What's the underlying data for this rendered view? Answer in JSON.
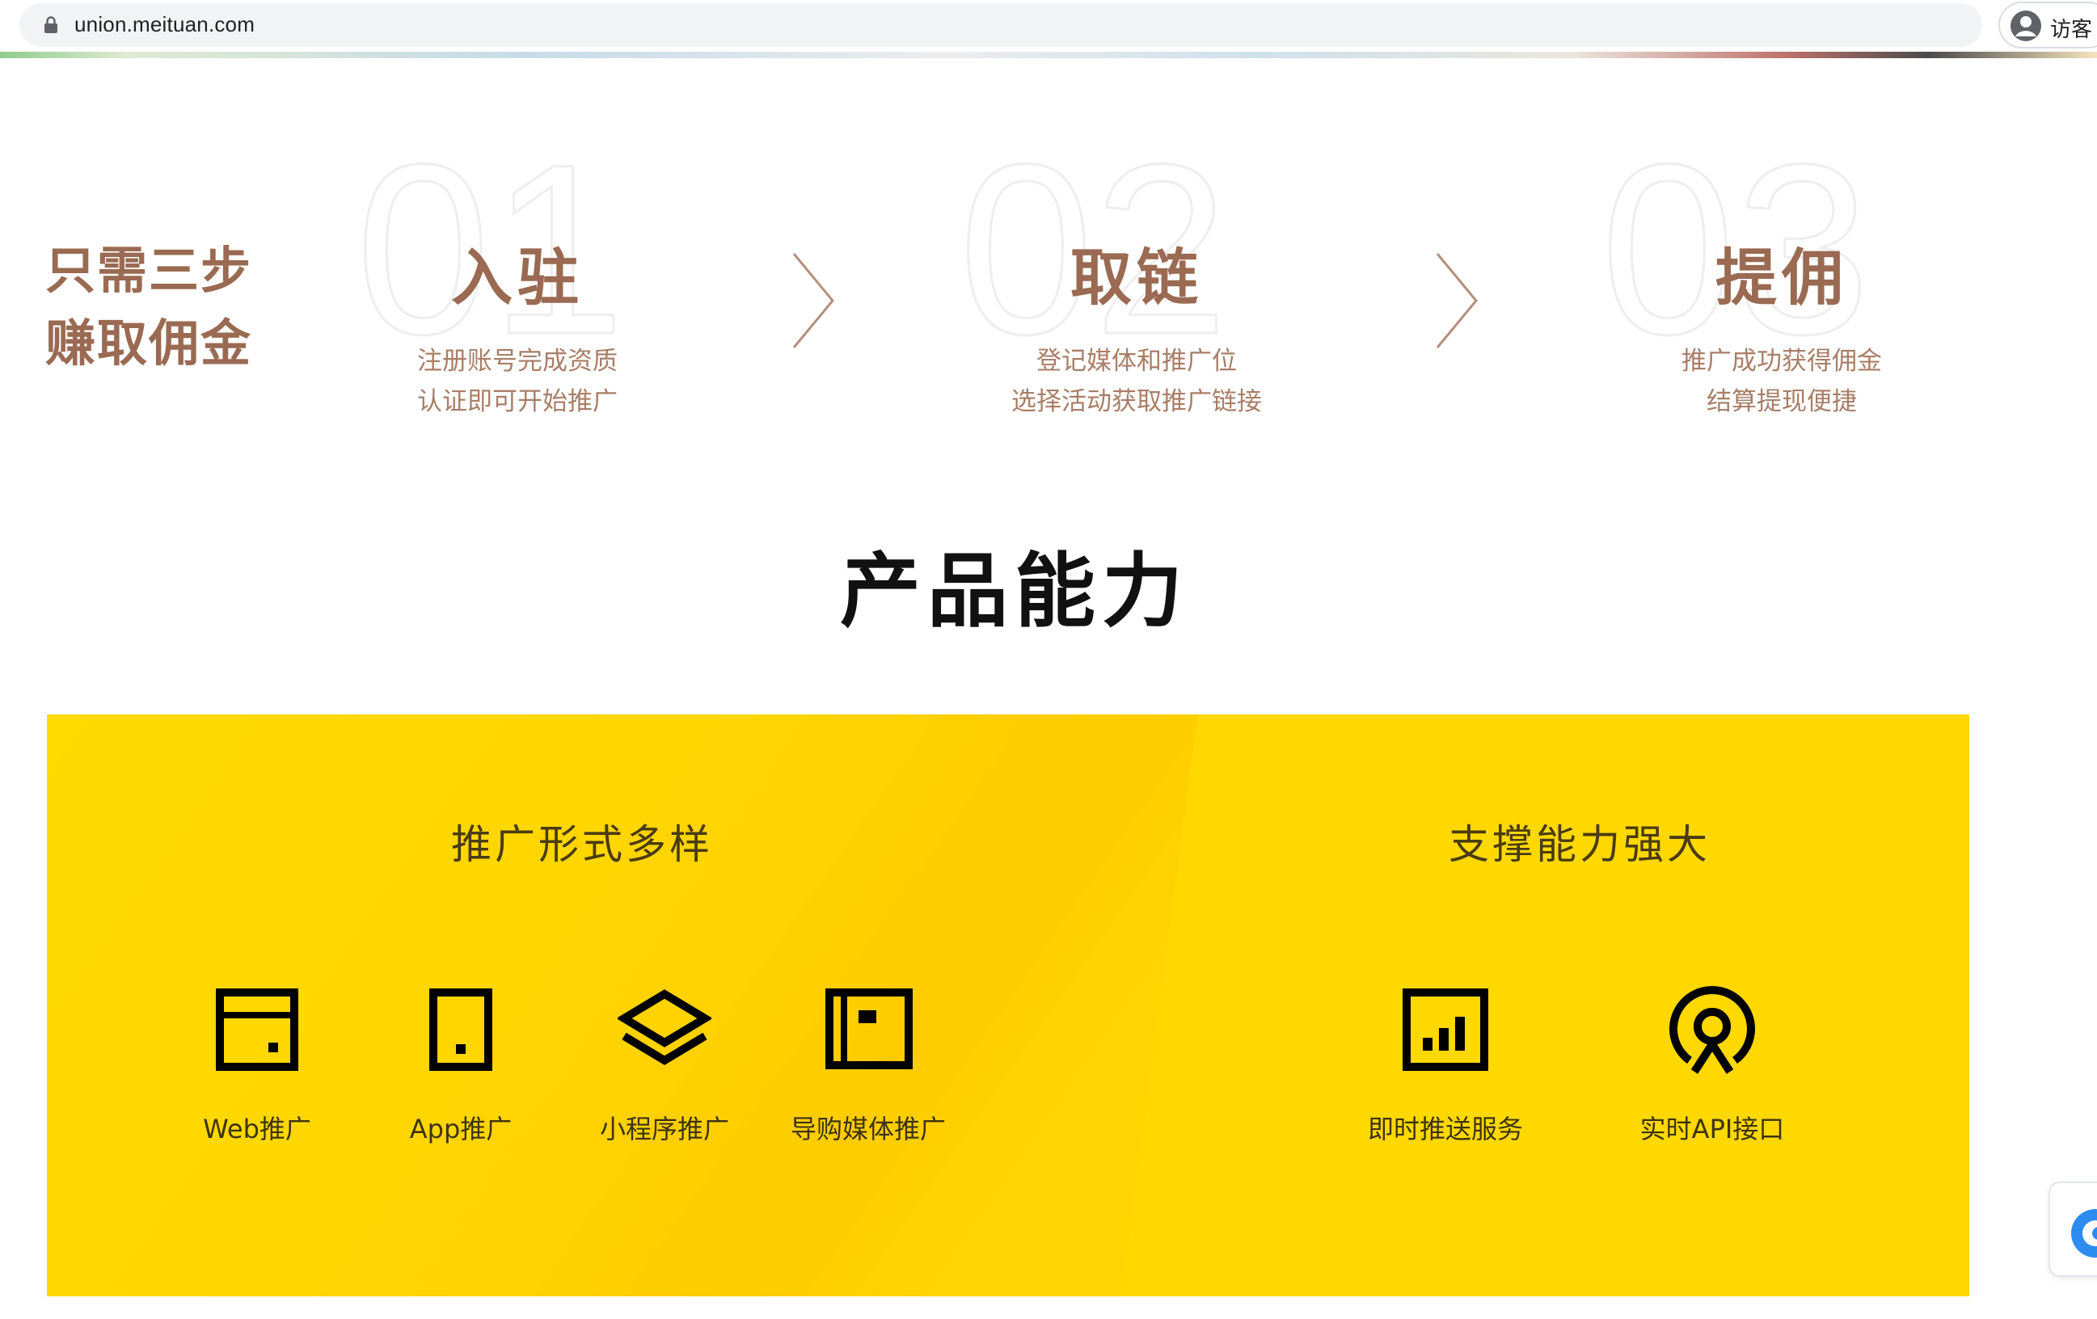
{
  "browser": {
    "url": "union.meituan.com",
    "profile_label": "访客"
  },
  "steps_section": {
    "headline_line1": "只需三步",
    "headline_line2": "赚取佣金",
    "steps": [
      {
        "number": "01",
        "title": "入驻",
        "desc_line1": "注册账号完成资质",
        "desc_line2": "认证即可开始推广"
      },
      {
        "number": "02",
        "title": "取链",
        "desc_line1": "登记媒体和推广位",
        "desc_line2": "选择活动获取推广链接"
      },
      {
        "number": "03",
        "title": "提佣",
        "desc_line1": "推广成功获得佣金",
        "desc_line2": "结算提现便捷"
      }
    ]
  },
  "product_section": {
    "title": "产品能力",
    "left_heading": "推广形式多样",
    "right_heading": "支撑能力强大",
    "left_features": [
      {
        "label": "Web推广",
        "icon": "browser-window-icon"
      },
      {
        "label": "App推广",
        "icon": "phone-icon"
      },
      {
        "label": "小程序推广",
        "icon": "layers-icon"
      },
      {
        "label": "导购媒体推广",
        "icon": "newspaper-icon"
      }
    ],
    "right_features": [
      {
        "label": "即时推送服务",
        "icon": "bar-chart-icon"
      },
      {
        "label": "实时API接口",
        "icon": "broadcast-icon"
      }
    ]
  },
  "colors": {
    "brand_brown": "#9a6a52",
    "panel_yellow": "#ffd800",
    "title_black": "#111111"
  }
}
